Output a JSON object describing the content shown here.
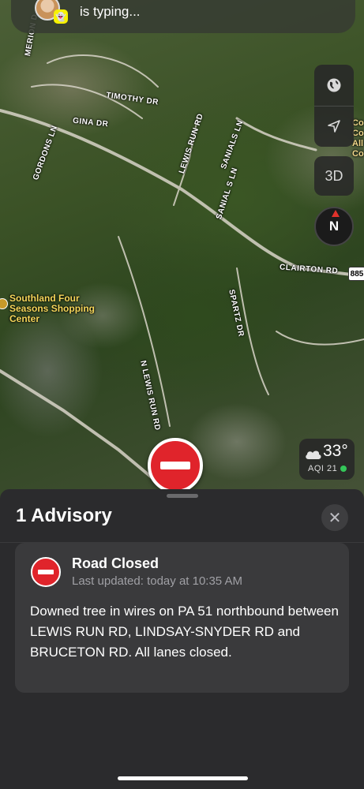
{
  "typing_banner": {
    "status": "is typing..."
  },
  "map": {
    "roads": [
      "MERION D",
      "TIMOTHY DR",
      "GINA DR",
      "GORDONS LN",
      "LEWIS RUN RD",
      "SANIALS LN",
      "SANIAL S LN",
      "CLAIRTON RD",
      "SPARTZ DR",
      "N LEWIS RUN RD"
    ],
    "route_shield": "885",
    "poi": "Southland Four Seasons Shopping Center",
    "edge_text": [
      "Co",
      "Co",
      "All",
      "Co"
    ]
  },
  "controls": {
    "three_d": "3D",
    "compass": "N"
  },
  "weather": {
    "temperature": "33°",
    "aqi": "AQI 21"
  },
  "sheet": {
    "title": "1 Advisory",
    "close": "✕",
    "advisory": {
      "title": "Road Closed",
      "updated": "Last updated: today at 10:35 AM",
      "description": "Downed tree in wires on PA 51 northbound between LEWIS RUN RD, LINDSAY-SNYDER RD and BRUCETON RD. All lanes closed."
    }
  }
}
